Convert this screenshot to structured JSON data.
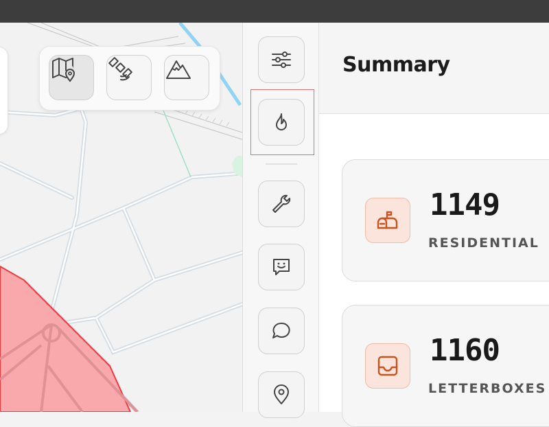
{
  "map": {
    "layer_buttons": [
      {
        "name": "map-view",
        "icon": "map-pin-icon",
        "active": true
      },
      {
        "name": "satellite-view",
        "icon": "satellite-icon",
        "active": false
      },
      {
        "name": "terrain-view",
        "icon": "mountain-icon",
        "active": false
      }
    ],
    "zone_color": "#f9a9ab",
    "zone_stroke": "#ee3a3d"
  },
  "sidebar": {
    "items": [
      {
        "name": "filters",
        "icon": "sliders-icon"
      },
      {
        "name": "heatmap",
        "icon": "flame-icon",
        "highlighted": true
      },
      {
        "name": "tools",
        "icon": "wrench-icon"
      },
      {
        "name": "feedback",
        "icon": "smiley-message-icon"
      },
      {
        "name": "chat",
        "icon": "chat-bubble-icon"
      },
      {
        "name": "location",
        "icon": "location-pin-icon"
      }
    ]
  },
  "summary": {
    "title": "Summary",
    "cards": [
      {
        "value": "1149",
        "label": "RESIDENTIAL",
        "icon": "mailbox-icon"
      },
      {
        "value": "1160",
        "label": "LETTERBOXES",
        "icon": "inbox-tray-icon"
      }
    ],
    "accent_color": "#c8531f"
  }
}
